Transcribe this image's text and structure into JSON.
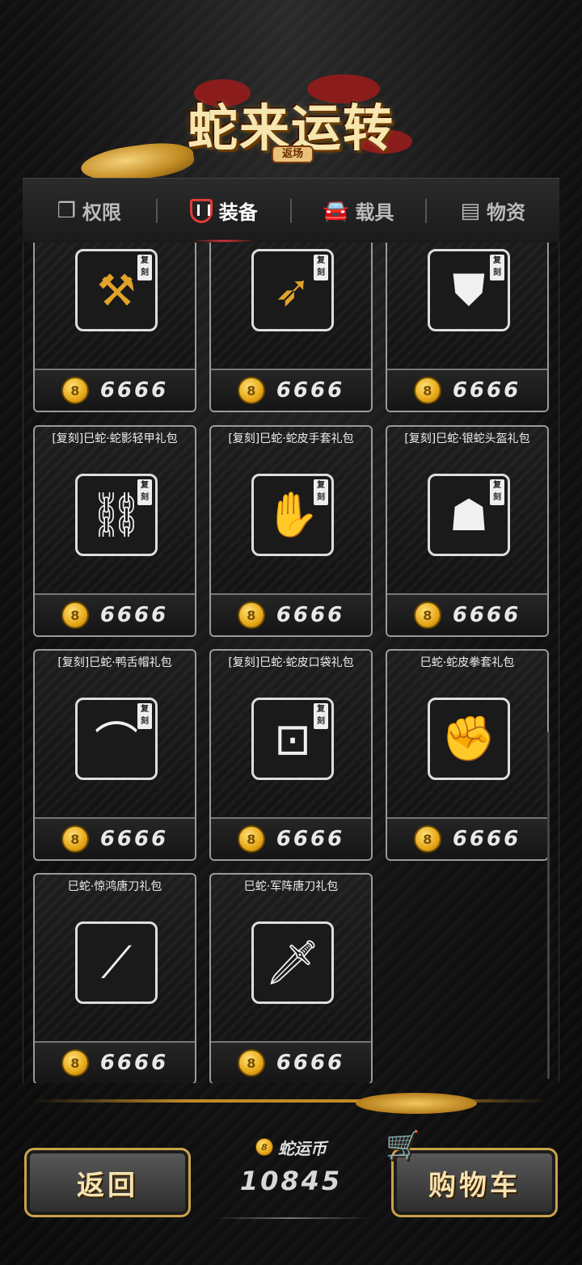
{
  "header": {
    "title": "蛇来运转",
    "subtitle": "返场"
  },
  "tabs": [
    {
      "label": "权限",
      "icon": "box-icon"
    },
    {
      "label": "装备",
      "icon": "shield-icon",
      "active": true
    },
    {
      "label": "载具",
      "icon": "car-icon"
    },
    {
      "label": "物资",
      "icon": "crate-icon"
    }
  ],
  "items": [
    {
      "name": "",
      "tag": "复刻",
      "icon": "golden-mace-icon",
      "price": "6666"
    },
    {
      "name": "",
      "tag": "复刻",
      "icon": "golden-gun-icon",
      "price": "6666"
    },
    {
      "name": "",
      "tag": "复刻",
      "icon": "vest-icon",
      "price": "6666"
    },
    {
      "name": "[复刻]巳蛇·蛇影轻甲礼包",
      "tag": "复刻",
      "icon": "light-armor-icon",
      "price": "6666"
    },
    {
      "name": "[复刻]巳蛇·蛇皮手套礼包",
      "tag": "复刻",
      "icon": "gloves-icon",
      "price": "6666"
    },
    {
      "name": "[复刻]巳蛇·银蛇头盔礼包",
      "tag": "复刻",
      "icon": "helmet-icon",
      "price": "6666"
    },
    {
      "name": "[复刻]巳蛇·鸭舌帽礼包",
      "tag": "复刻",
      "icon": "cap-icon",
      "price": "6666"
    },
    {
      "name": "[复刻]巳蛇·蛇皮口袋礼包",
      "tag": "复刻",
      "icon": "bag-icon",
      "price": "6666"
    },
    {
      "name": "巳蛇·蛇皮拳套礼包",
      "tag": "",
      "icon": "fist-glove-icon",
      "price": "6666"
    },
    {
      "name": "巳蛇·惊鸿唐刀礼包",
      "tag": "",
      "icon": "katana-icon",
      "price": "6666"
    },
    {
      "name": "巳蛇·军阵唐刀礼包",
      "tag": "",
      "icon": "sword-icon",
      "price": "6666"
    }
  ],
  "footer": {
    "back_label": "返回",
    "currency_label": "蛇运币",
    "currency_value": "10845",
    "cart_label": "购物车",
    "coin_glyph": "8"
  }
}
